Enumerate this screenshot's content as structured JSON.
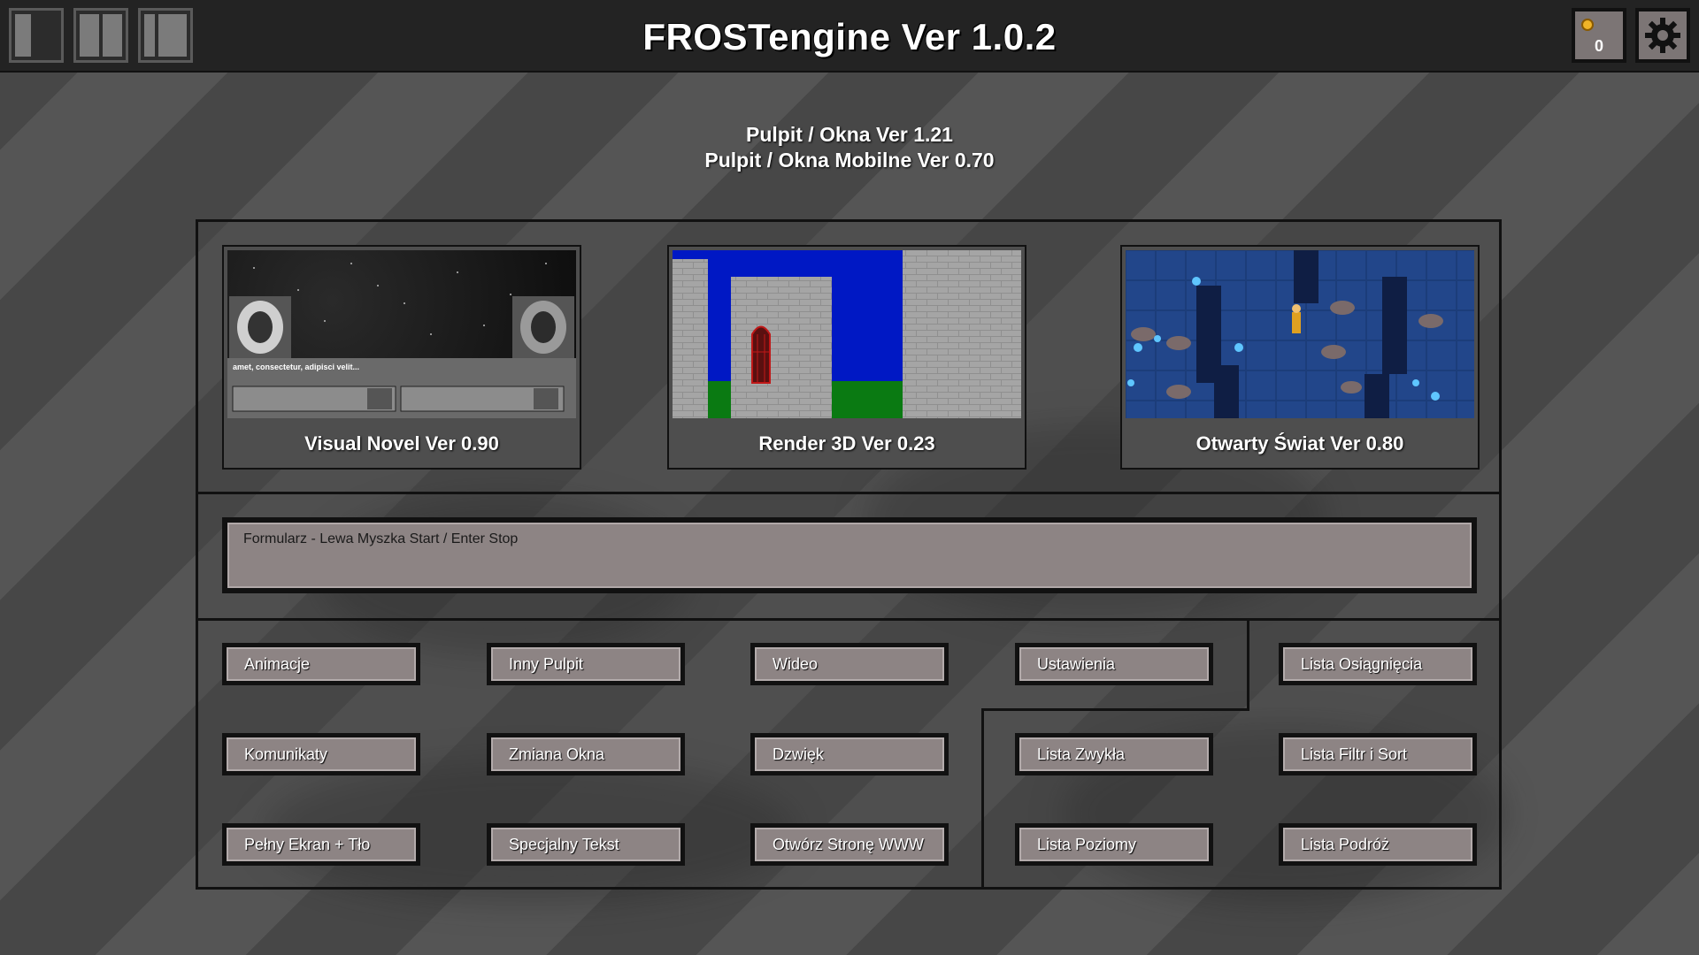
{
  "header": {
    "title": "FROSTengine Ver 1.0.2",
    "coins": "0"
  },
  "versions": {
    "line1": "Pulpit / Okna Ver 1.21",
    "line2": "Pulpit / Okna Mobilne Ver 0.70"
  },
  "cards": [
    {
      "label": "Visual Novel Ver 0.90",
      "vn_dialog": "amet, consectetur, adipisci velit..."
    },
    {
      "label": "Render 3D Ver 0.23"
    },
    {
      "label": "Otwarty Świat Ver 0.80"
    }
  ],
  "form": {
    "hint": "Formularz - Lewa Myszka Start / Enter Stop"
  },
  "buttons": {
    "animacje": "Animacje",
    "inny_pulpit": "Inny Pulpit",
    "wideo": "Wideo",
    "ustawienia": "Ustawienia",
    "lista_osiagniecia": "Lista Osiągnięcia",
    "komunikaty": "Komunikaty",
    "zmiana_okna": "Zmiana Okna",
    "dzwiek": "Dzwięk",
    "lista_zwykla": "Lista Zwykła",
    "lista_filtr_sort": "Lista Filtr i Sort",
    "pelny_ekran": "Pełny Ekran + Tło",
    "specjalny_tekst": "Specjalny Tekst",
    "otworz_strone": "Otwórz Stronę WWW",
    "lista_poziomy": "Lista Poziomy",
    "lista_podroz": "Lista Podróż"
  },
  "icons": {
    "window_layouts": [
      "window-layout-1-icon",
      "window-layout-2-icon",
      "window-layout-3-icon"
    ],
    "coin": "coin-icon",
    "settings": "gear-icon"
  },
  "colors": {
    "topbar": "#232323",
    "button_fill": "#8d8484",
    "coin": "#f0b428"
  }
}
